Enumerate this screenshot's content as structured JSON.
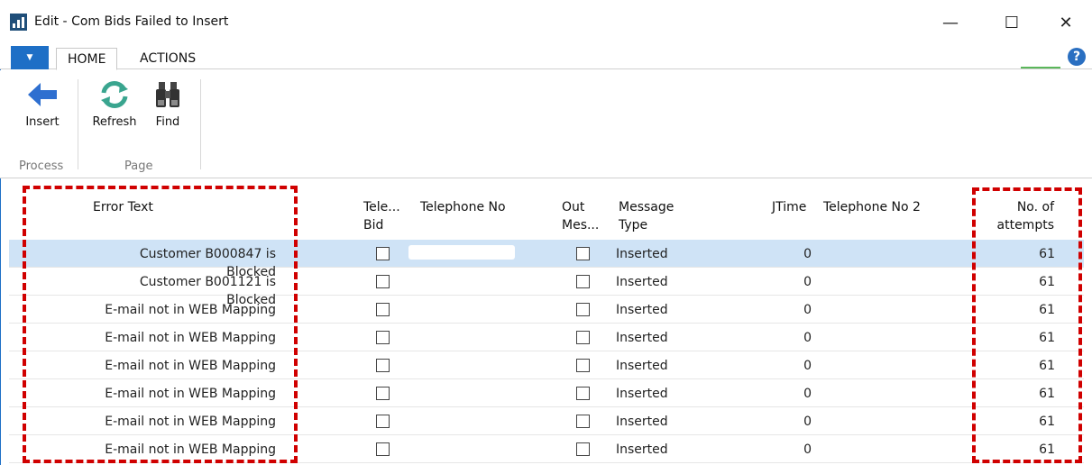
{
  "window": {
    "title": "Edit - Com Bids Failed to Insert",
    "minimize_glyph": "—",
    "maximize_glyph": "☐",
    "close_glyph": "✕"
  },
  "tabs": {
    "menu_arrow": "▼",
    "home": "HOME",
    "actions": "ACTIONS",
    "help": "?"
  },
  "ribbon": {
    "insert_label": "Insert",
    "refresh_label": "Refresh",
    "find_label": "Find",
    "group_process": "Process",
    "group_page": "Page"
  },
  "grid": {
    "headers": {
      "error_text": "Error Text",
      "tele_bid": "Tele... Bid",
      "telephone_no": "Telephone No",
      "out_mes": "Out Mes...",
      "message_type": "Message Type",
      "jtime": "JTime",
      "telephone_no_2": "Telephone No 2",
      "attempts": "No. of attempts"
    },
    "rows": [
      {
        "error_text": "Customer B000847 is Blocked",
        "message_type": "Inserted",
        "jtime": "0",
        "attempts": "61"
      },
      {
        "error_text": "Customer B001121 is Blocked",
        "message_type": "Inserted",
        "jtime": "0",
        "attempts": "61"
      },
      {
        "error_text": "E-mail not in WEB Mapping",
        "message_type": "Inserted",
        "jtime": "0",
        "attempts": "61"
      },
      {
        "error_text": "E-mail not in WEB Mapping",
        "message_type": "Inserted",
        "jtime": "0",
        "attempts": "61"
      },
      {
        "error_text": "E-mail not in WEB Mapping",
        "message_type": "Inserted",
        "jtime": "0",
        "attempts": "61"
      },
      {
        "error_text": "E-mail not in WEB Mapping",
        "message_type": "Inserted",
        "jtime": "0",
        "attempts": "61"
      },
      {
        "error_text": "E-mail not in WEB Mapping",
        "message_type": "Inserted",
        "jtime": "0",
        "attempts": "61"
      },
      {
        "error_text": "E-mail not in WEB Mapping",
        "message_type": "Inserted",
        "jtime": "0",
        "attempts": "61"
      }
    ]
  },
  "colors": {
    "accent": "#1e6fc6",
    "selected_row": "#cfe3f6",
    "annotation": "#d00000"
  }
}
